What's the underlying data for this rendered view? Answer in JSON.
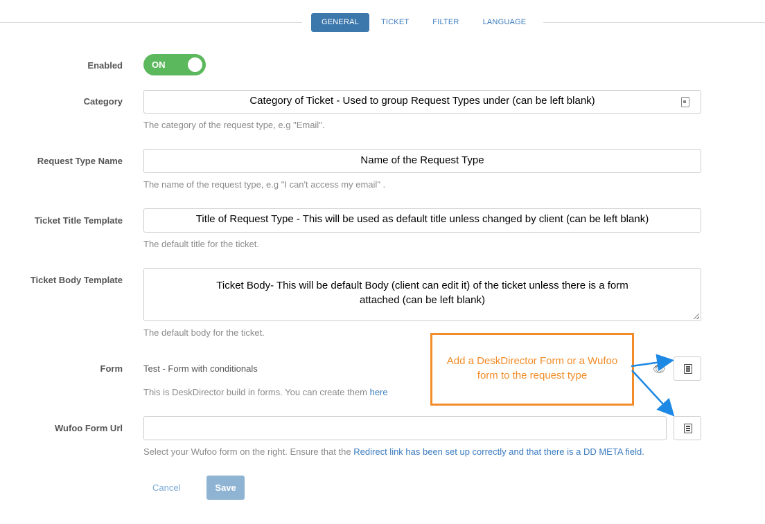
{
  "tabs": [
    {
      "label": "GENERAL",
      "active": true
    },
    {
      "label": "TICKET",
      "active": false
    },
    {
      "label": "FILTER",
      "active": false
    },
    {
      "label": "LANGUAGE",
      "active": false
    }
  ],
  "enabled": {
    "label": "Enabled",
    "toggle_text": "ON",
    "state": "on",
    "color": "#5cb85c"
  },
  "category": {
    "label": "Category",
    "value": "Category of Ticket - Used to group Request Types under (can be left blank)",
    "help": "The category of the request type, e.g \"Email\"."
  },
  "request_type_name": {
    "label": "Request Type Name",
    "value": "Name of the Request Type",
    "help": "The name of the request type, e.g \"I can't access my email\" ."
  },
  "ticket_title_template": {
    "label": "Ticket Title Template",
    "value": "Title of Request Type - This will be used as default title unless changed by client (can be left blank)",
    "help": "The default title for the ticket."
  },
  "ticket_body_template": {
    "label": "Ticket Body Template",
    "value_line1": "Ticket Body- This will be default Body (client can edit it) of the ticket unless there is a form",
    "value_line2": "attached (can be left blank)",
    "help": "The default body for the ticket."
  },
  "form": {
    "label": "Form",
    "value": "Test - Form with conditionals",
    "help": "This is DeskDirector build in forms. You can create them",
    "help_link": "here"
  },
  "wufoo": {
    "label": "Wufoo Form Url",
    "value": "",
    "help": "Select your Wufoo form on the right. Ensure that the",
    "help_link": "Redirect link has been set up correctly and that there is a DD META field."
  },
  "actions": {
    "cancel": "Cancel",
    "save": "Save"
  },
  "callout": {
    "line1": "Add a DeskDirector Form or a Wufoo",
    "line2": "form to the request type",
    "color": "#f28c28",
    "arrow_color": "#1e88e5"
  },
  "colors": {
    "accent": "#3d78ad",
    "link": "#3a7bbf",
    "toggle_on": "#5cb85c"
  }
}
